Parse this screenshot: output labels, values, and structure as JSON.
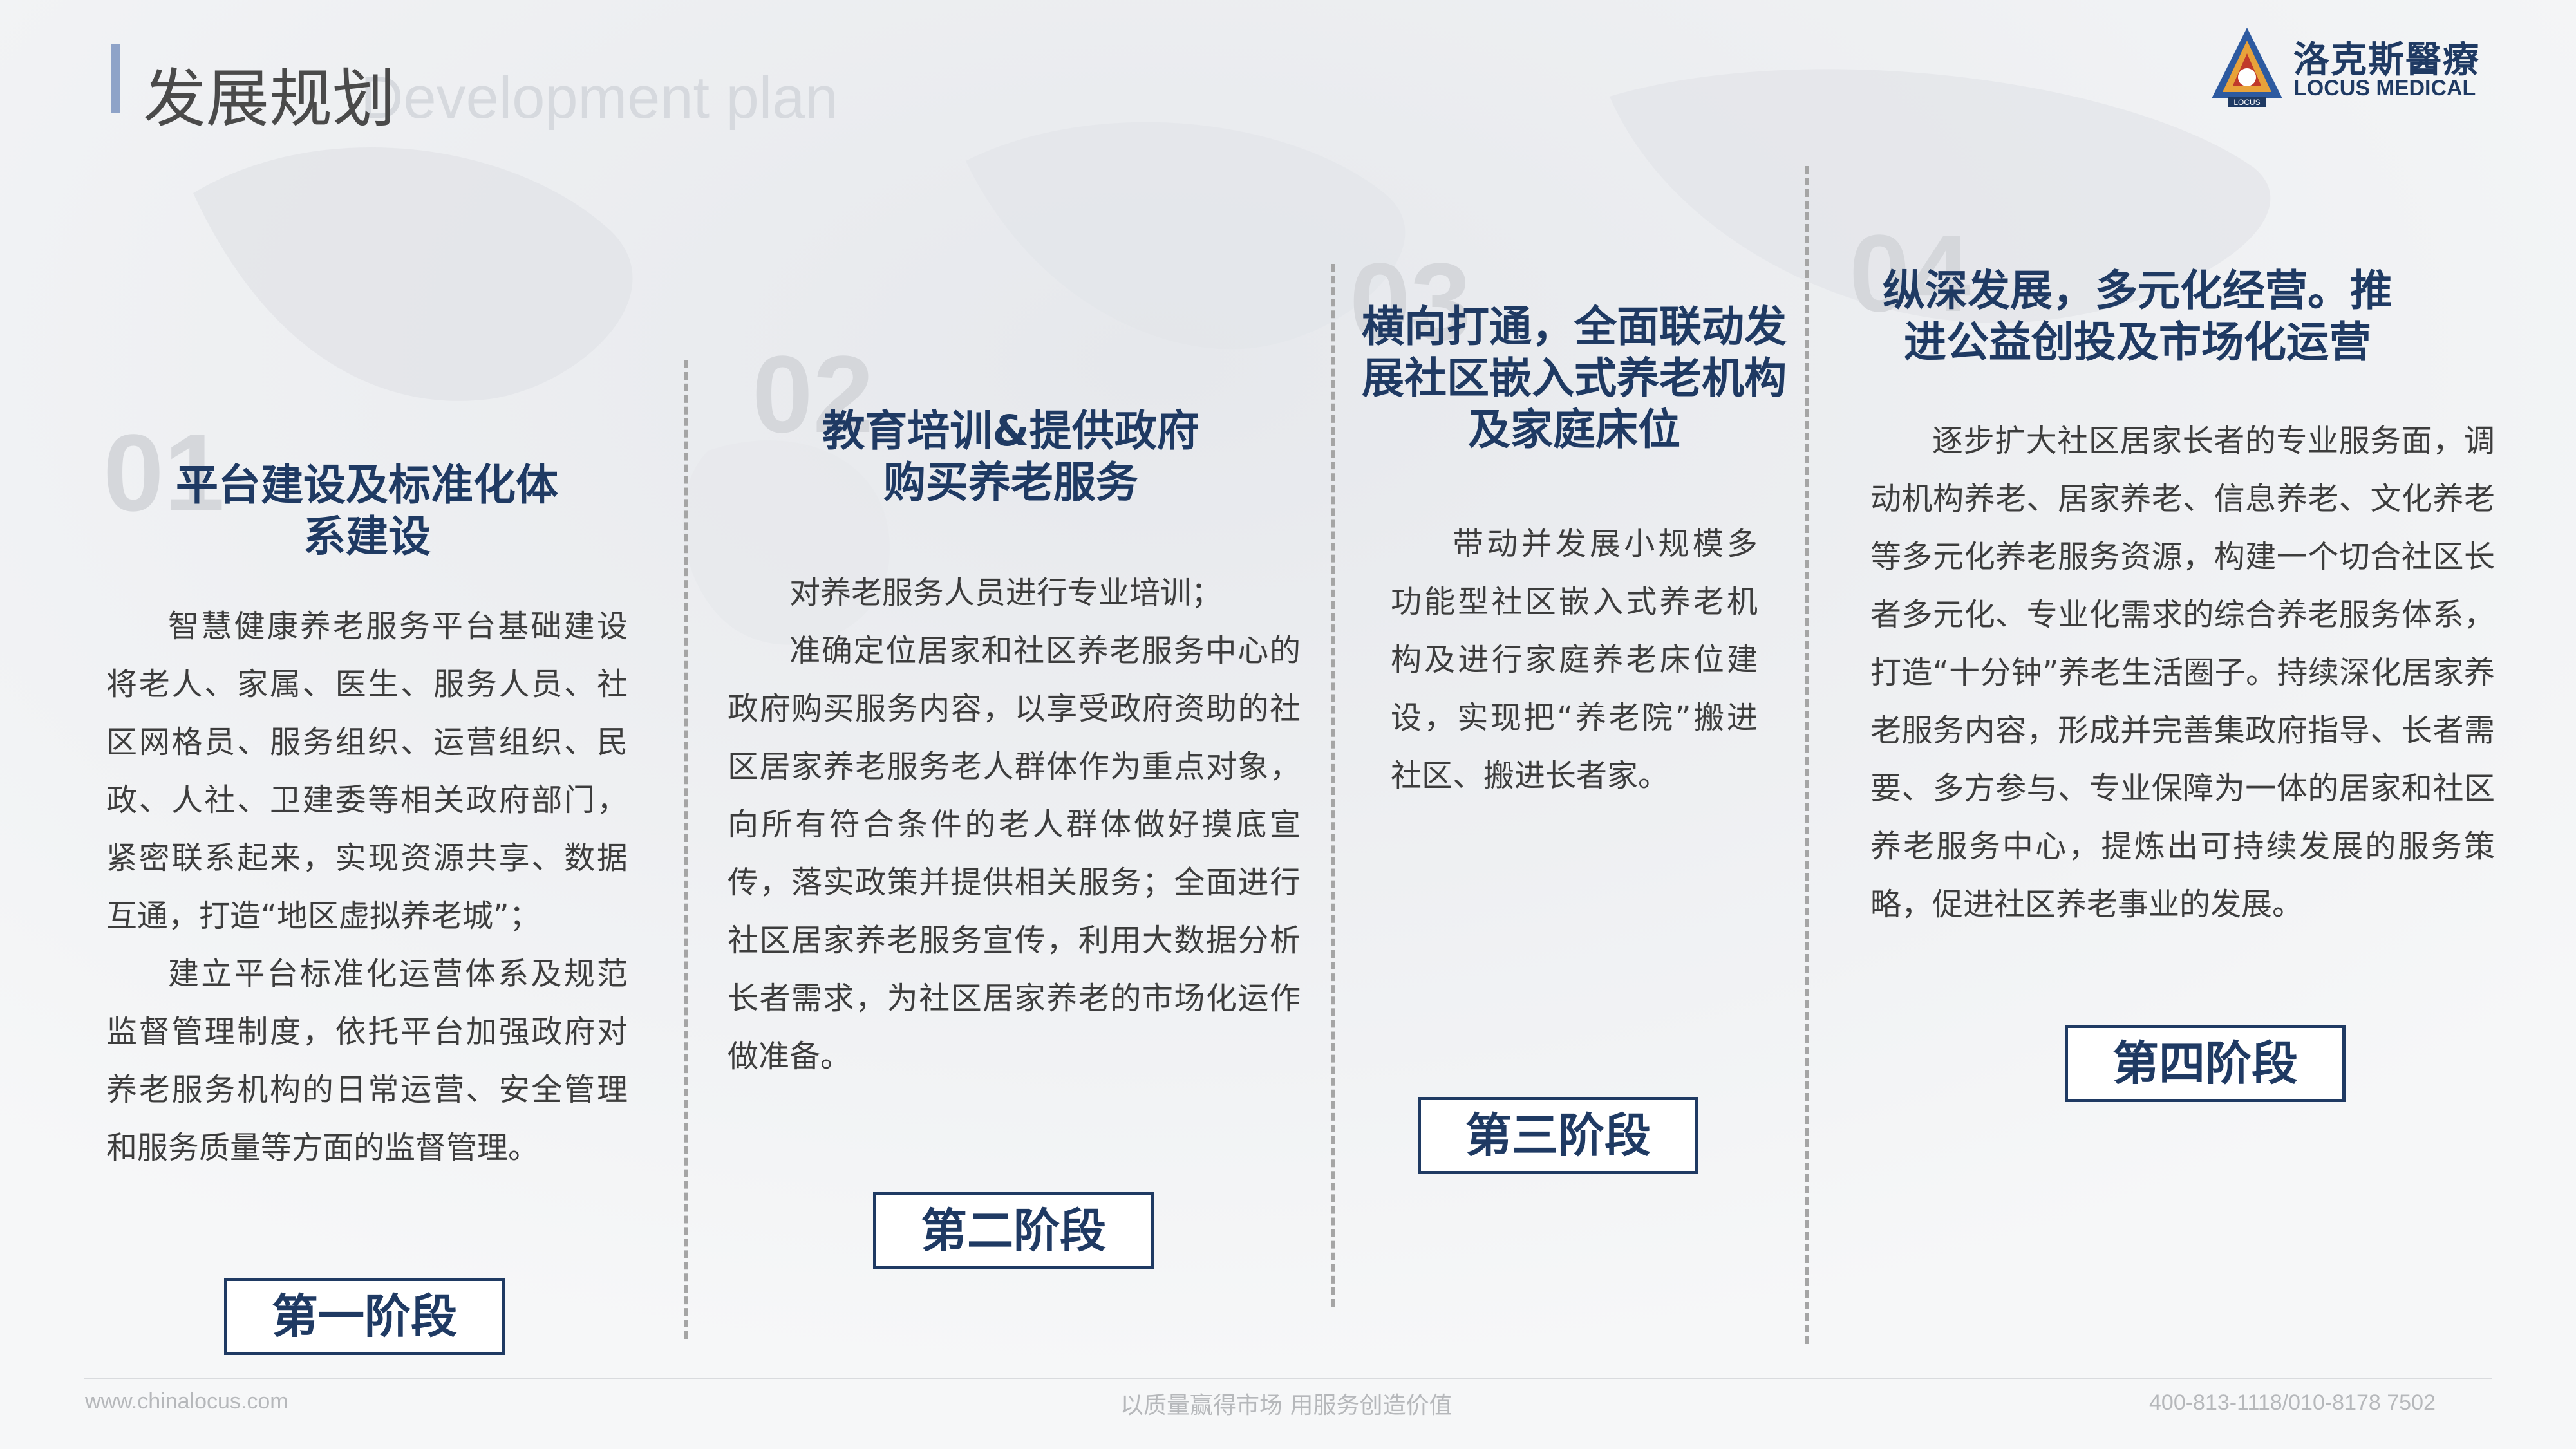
{
  "header": {
    "title": "发展规划",
    "title_background": "Development plan",
    "logo_cn": "洛克斯醫療",
    "logo_en": "LOCUS MEDICAL",
    "logo_badge": "LOCUS"
  },
  "stages": [
    {
      "number": "01",
      "heading": "平台建设及标准化体系建设",
      "paragraphs": [
        "智慧健康养老服务平台基础建设将老人、家属、医生、服务人员、社区网格员、服务组织、运营组织、民政、人社、卫建委等相关政府部门，紧密联系起来，实现资源共享、数据互通，打造“地区虚拟养老城”；",
        "建立平台标准化运营体系及规范监督管理制度，依托平台加强政府对养老服务机构的日常运营、安全管理和服务质量等方面的监督管理。"
      ],
      "stage_label": "第一阶段"
    },
    {
      "number": "02",
      "heading": "教育培训&提供政府购买养老服务",
      "paragraphs": [
        "对养老服务人员进行专业培训；",
        "准确定位居家和社区养老服务中心的政府购买服务内容，以享受政府资助的社区居家养老服务老人群体作为重点对象，向所有符合条件的老人群体做好摸底宣传，落实政策并提供相关服务；全面进行社区居家养老服务宣传，利用大数据分析长者需求，为社区居家养老的市场化运作做准备。"
      ],
      "stage_label": "第二阶段"
    },
    {
      "number": "03",
      "heading": "横向打通，全面联动发展社区嵌入式养老机构及家庭床位",
      "paragraphs": [
        "带动并发展小规模多功能型社区嵌入式养老机构及进行家庭养老床位建设，实现把“养老院”搬进社区、搬进长者家。"
      ],
      "stage_label": "第三阶段"
    },
    {
      "number": "04",
      "heading": "纵深发展，多元化经营。推进公益创投及市场化运营",
      "paragraphs": [
        "逐步扩大社区居家长者的专业服务面，调动机构养老、居家养老、信息养老、文化养老等多元化养老服务资源，构建一个切合社区长者多元化、专业化需求的综合养老服务体系，打造“十分钟”养老生活圈子。持续深化居家养老服务内容，形成并完善集政府指导、长者需要、多方参与、专业保障为一体的居家和社区养老服务中心，提炼出可持续发展的服务策略，促进社区养老事业的发展。"
      ],
      "stage_label": "第四阶段"
    }
  ],
  "footer": {
    "website": "www.chinalocus.com",
    "slogan": "以质量赢得市场 用服务创造价值",
    "phone": "400-813-1118/010-8178 7502"
  },
  "colors": {
    "accent": "#1f3a63",
    "header_bar": "#8ea3c8",
    "divider": "#a5a5a5",
    "number_watermark": "#d5d7db"
  }
}
